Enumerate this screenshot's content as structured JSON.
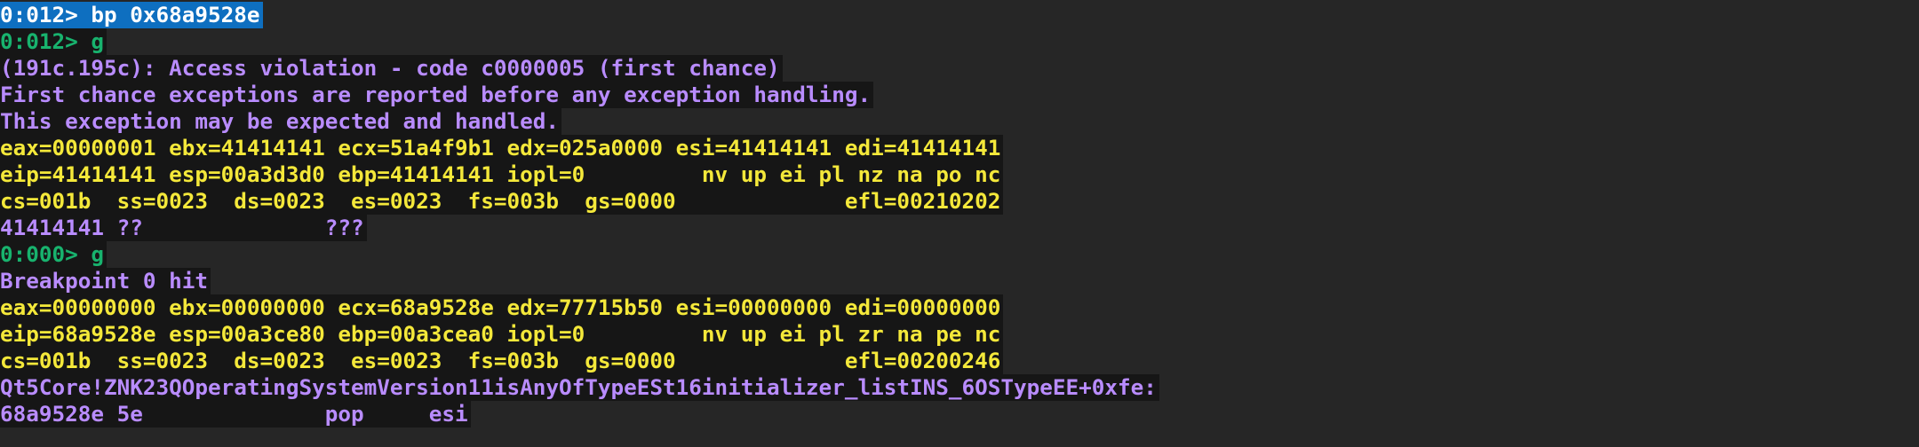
{
  "colors": {
    "background": "#262626",
    "line_background": "#161616",
    "selection": "#0e6fc0",
    "prompt_green": "#18b36e",
    "output_purple": "#b98cff",
    "register_yellow": "#f4e83a"
  },
  "console": {
    "lines": [
      {
        "kind": "selected",
        "text": "0:012> bp 0x68a9528e"
      },
      {
        "kind": "prompt",
        "prompt": "0:012> ",
        "command": "g"
      },
      {
        "kind": "output",
        "text": "(191c.195c): Access violation - code c0000005 (first chance)"
      },
      {
        "kind": "output",
        "text": "First chance exceptions are reported before any exception handling."
      },
      {
        "kind": "output",
        "text": "This exception may be expected and handled."
      },
      {
        "kind": "regs",
        "text": "eax=00000001 ebx=41414141 ecx=51a4f9b1 edx=025a0000 esi=41414141 edi=41414141"
      },
      {
        "kind": "regs",
        "text": "eip=41414141 esp=00a3d3d0 ebp=41414141 iopl=0         nv up ei pl nz na po nc"
      },
      {
        "kind": "regs",
        "text": "cs=001b  ss=0023  ds=0023  es=0023  fs=003b  gs=0000             efl=00210202"
      },
      {
        "kind": "output",
        "text": "41414141 ??              ???"
      },
      {
        "kind": "prompt",
        "prompt": "0:000> ",
        "command": "g"
      },
      {
        "kind": "output",
        "text": "Breakpoint 0 hit"
      },
      {
        "kind": "regs",
        "text": "eax=00000000 ebx=00000000 ecx=68a9528e edx=77715b50 esi=00000000 edi=00000000"
      },
      {
        "kind": "regs",
        "text": "eip=68a9528e esp=00a3ce80 ebp=00a3cea0 iopl=0         nv up ei pl zr na pe nc"
      },
      {
        "kind": "regs",
        "text": "cs=001b  ss=0023  ds=0023  es=0023  fs=003b  gs=0000             efl=00200246"
      },
      {
        "kind": "output",
        "text": "Qt5Core!ZNK23QOperatingSystemVersion11isAnyOfTypeESt16initializer_listINS_6OSTypeEE+0xfe:"
      },
      {
        "kind": "output",
        "text": "68a9528e 5e              pop     esi"
      }
    ]
  }
}
